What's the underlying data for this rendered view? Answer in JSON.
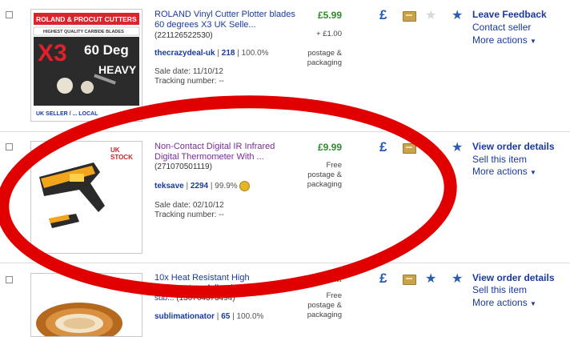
{
  "rows": [
    {
      "image_banner": "ROLAND & PROCUT CUTTERS",
      "image_sub": "HIGHEST QUALITY CARBIDE BLADES",
      "image_big": "X3",
      "image_deg": "60 Deg",
      "image_heavy": "HEAVY",
      "image_footer": "UK SELLER / ... LOCAL",
      "title": "ROLAND Vinyl Cutter Plotter blades 60 degrees X3 UK Selle...",
      "item_number": "(221126522530)",
      "seller_name": "thecrazydeal-uk",
      "seller_score": "218",
      "seller_pct": "100.0%",
      "sale_date": "Sale date: 11/10/12",
      "tracking": "Tracking number: --",
      "price": "£5.99",
      "postage": "+ £1.00",
      "postage_label_1": "postage &",
      "postage_label_2": "packaging",
      "action_primary": "Leave Feedback",
      "action_2": "Contact seller",
      "action_3": "More actions"
    },
    {
      "image_badge": "UK STOCK",
      "title": "Non-Contact Digital IR Infrared Digital Thermometer With ...",
      "item_number": "(271070501119)",
      "seller_name": "teksave",
      "seller_score": "2294",
      "seller_pct": "99.9%",
      "sale_date": "Sale date: 02/10/12",
      "tracking": "Tracking number: --",
      "price": "£9.99",
      "postage_1": "Free",
      "postage_2": "postage &",
      "postage_3": "packaging",
      "action_primary": "View order details",
      "action_2": "Sell this item",
      "action_3": "More actions"
    },
    {
      "title": "10x Heat Resistant High ... Adhesive Tape ... sub...",
      "title_line1": "10x Heat Resistant High",
      "title_line2": "Temperature Adhesive Tape",
      "title_line3": "sub...",
      "item_number": "(130764373494)",
      "seller_name": "sublimationator",
      "seller_score": "65",
      "seller_pct": "100.0%",
      "price": "£1...",
      "postage_1": "Free",
      "postage_2": "postage &",
      "postage_3": "packaging",
      "action_primary": "View order details",
      "action_2": "Sell this item",
      "action_3": "More actions"
    }
  ],
  "icons": {
    "pound": "£",
    "star": "★",
    "caret": "▼"
  },
  "colors": {
    "link": "#1a3a9e",
    "visited": "#7a2a9a",
    "price": "#2e8b2e",
    "annotation": "#e00000"
  }
}
